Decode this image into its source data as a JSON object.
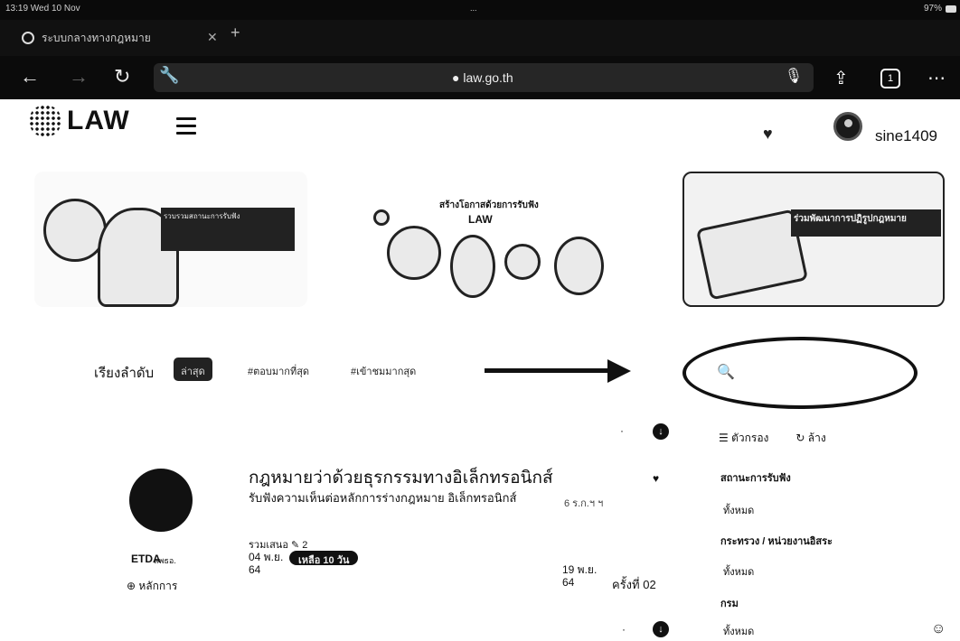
{
  "browser": {
    "status_time": "13:19  Wed 10 Nov",
    "status_center": "...",
    "status_right": "97%",
    "tab_title": "ระบบกลางทางกฎหมาย",
    "tab_close": "✕",
    "tab_new": "+",
    "url": "● law.go.th",
    "tabs_count": "1"
  },
  "site": {
    "logo_text": "LAW",
    "username": "sine1409"
  },
  "banners": [
    {
      "caption": "รวบรวมสถานะการรับฟัง"
    },
    {
      "caption": "สร้างโอกาสด้วยการรับฟัง",
      "subcaption": "LAW"
    },
    {
      "caption": "ร่วมพัฒนาการปฏิรูปกฎหมาย"
    }
  ],
  "sort": {
    "label": "เรียงลำดับ",
    "options": [
      "ล่าสุด",
      "#ตอบมากที่สุด",
      "#เข้าชมมากสุด"
    ]
  },
  "list_item": {
    "title": "กฎหมายว่าด้วยธุรกรรมทางอิเล็กทรอนิกส์",
    "description": "รับฟังความเห็นต่อหลักการร่างกฎหมาย อิเล็กทรอนิกส์",
    "meta": "6  ร.ก.ฯ ฯ",
    "org": "ETDA",
    "org_name": "สพธอ.",
    "principle": "⊕ หลักการ",
    "stats": "รวมเสนอ  ✎ 2",
    "date_start": "04 พ.ย. 64",
    "badge": "เหลือ 10 วัน",
    "date_end": "19 พ.ย. 64",
    "times": "ครั้งที่ 02"
  },
  "filters": {
    "menu_label": "ตัวกรอง",
    "clear_label": "ล้าง",
    "groups": [
      {
        "heading": "สถานะการรับฟัง",
        "value": "ทั้งหมด"
      },
      {
        "heading": "กระทรวง / หน่วยงานอิสระ",
        "value": "ทั้งหมด"
      },
      {
        "heading": "กรม",
        "value": "ทั้งหมด"
      }
    ]
  }
}
